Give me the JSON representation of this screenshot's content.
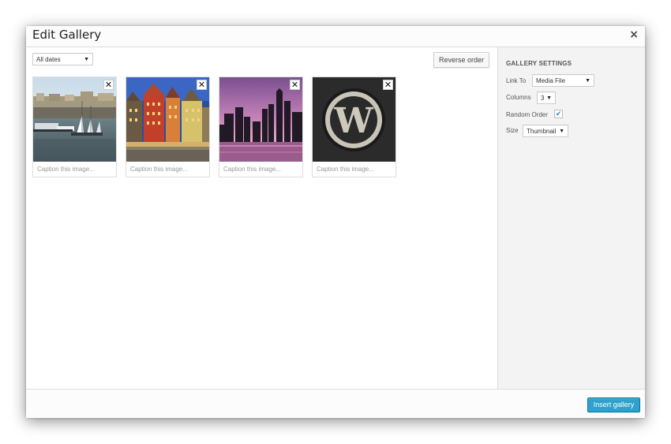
{
  "modal": {
    "title": "Edit Gallery",
    "close_label": "×"
  },
  "toolbar": {
    "date_filter": "All dates",
    "reverse_order_label": "Reverse order"
  },
  "gallery": {
    "items": [
      {
        "caption_placeholder": "Caption this image...",
        "remove_label": "✕",
        "subject": "harbor with boats"
      },
      {
        "caption_placeholder": "Caption this image...",
        "remove_label": "✕",
        "subject": "colorful town houses"
      },
      {
        "caption_placeholder": "Caption this image...",
        "remove_label": "✕",
        "subject": "city skyline at dusk"
      },
      {
        "caption_placeholder": "Caption this image...",
        "remove_label": "✕",
        "subject": "wordpress logo"
      }
    ]
  },
  "settings": {
    "title": "GALLERY SETTINGS",
    "link_to_label": "Link To",
    "link_to_value": "Media File",
    "columns_label": "Columns",
    "columns_value": "3",
    "random_order_label": "Random Order",
    "random_order_checked": true,
    "size_label": "Size",
    "size_value": "Thumbnail"
  },
  "footer": {
    "insert_label": "Insert gallery"
  },
  "colors": {
    "primary_button": "#2ea2cc",
    "sidebar_bg": "#f3f3f3",
    "checkbox_tick": "#1e8cbe"
  }
}
